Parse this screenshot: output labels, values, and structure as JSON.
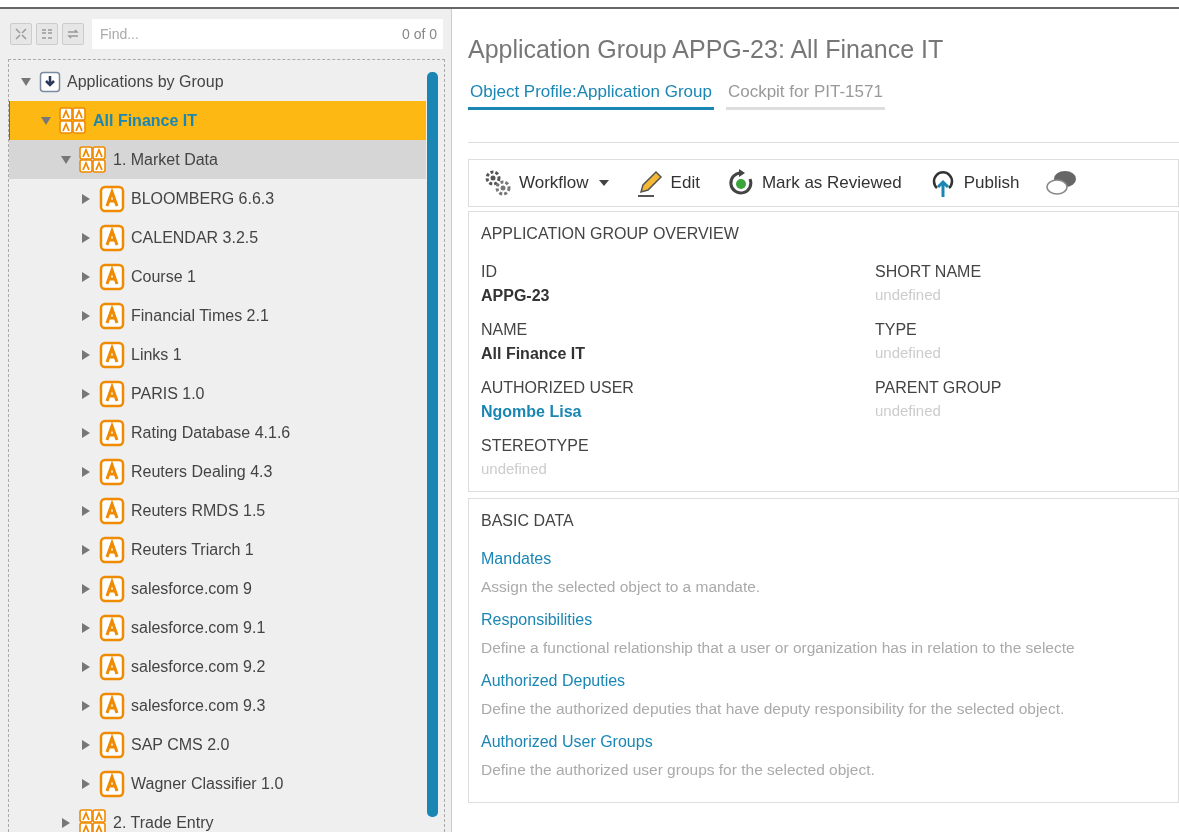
{
  "tree_toolbar": {
    "search": {
      "placeholder": "Find..."
    },
    "match_count": "0 of 0"
  },
  "tree": [
    {
      "label": "Applications by Group",
      "kind": "root",
      "expanded": true,
      "selected": false,
      "highlighted": false,
      "children": [
        {
          "label": "All Finance IT",
          "kind": "group",
          "expanded": true,
          "selected": true,
          "highlighted": false,
          "children": [
            {
              "label": "1. Market Data",
              "kind": "group",
              "expanded": true,
              "selected": false,
              "highlighted": true,
              "children": [
                {
                  "label": "BLOOMBERG 6.6.3",
                  "kind": "app",
                  "expanded": false,
                  "selected": false,
                  "highlighted": false
                },
                {
                  "label": "CALENDAR 3.2.5",
                  "kind": "app",
                  "expanded": false,
                  "selected": false,
                  "highlighted": false
                },
                {
                  "label": "Course 1",
                  "kind": "app",
                  "expanded": false,
                  "selected": false,
                  "highlighted": false
                },
                {
                  "label": "Financial Times 2.1",
                  "kind": "app",
                  "expanded": false,
                  "selected": false,
                  "highlighted": false
                },
                {
                  "label": "Links 1",
                  "kind": "app",
                  "expanded": false,
                  "selected": false,
                  "highlighted": false
                },
                {
                  "label": "PARIS 1.0",
                  "kind": "app",
                  "expanded": false,
                  "selected": false,
                  "highlighted": false
                },
                {
                  "label": "Rating Database 4.1.6",
                  "kind": "app",
                  "expanded": false,
                  "selected": false,
                  "highlighted": false
                },
                {
                  "label": "Reuters Dealing 4.3",
                  "kind": "app",
                  "expanded": false,
                  "selected": false,
                  "highlighted": false
                },
                {
                  "label": "Reuters RMDS 1.5",
                  "kind": "app",
                  "expanded": false,
                  "selected": false,
                  "highlighted": false
                },
                {
                  "label": "Reuters Triarch 1",
                  "kind": "app",
                  "expanded": false,
                  "selected": false,
                  "highlighted": false
                },
                {
                  "label": "salesforce.com 9",
                  "kind": "app",
                  "expanded": false,
                  "selected": false,
                  "highlighted": false
                },
                {
                  "label": "salesforce.com 9.1",
                  "kind": "app",
                  "expanded": false,
                  "selected": false,
                  "highlighted": false
                },
                {
                  "label": "salesforce.com 9.2",
                  "kind": "app",
                  "expanded": false,
                  "selected": false,
                  "highlighted": false
                },
                {
                  "label": "salesforce.com 9.3",
                  "kind": "app",
                  "expanded": false,
                  "selected": false,
                  "highlighted": false
                },
                {
                  "label": "SAP CMS 2.0",
                  "kind": "app",
                  "expanded": false,
                  "selected": false,
                  "highlighted": false
                },
                {
                  "label": "Wagner Classifier 1.0",
                  "kind": "app",
                  "expanded": false,
                  "selected": false,
                  "highlighted": false
                }
              ]
            },
            {
              "label": "2. Trade Entry",
              "kind": "group",
              "expanded": false,
              "selected": false,
              "highlighted": false
            }
          ]
        }
      ]
    }
  ],
  "page_title": "Application Group APPG-23: All Finance IT",
  "tabs": [
    {
      "label": "Object Profile:Application Group",
      "selected": true
    },
    {
      "label": "Cockpit for PIT-1571",
      "selected": false
    }
  ],
  "toolbar": [
    {
      "label": "Workflow",
      "kind": "gears",
      "dropdown": true
    },
    {
      "label": "Edit",
      "kind": "pencil",
      "dropdown": false
    },
    {
      "label": "Mark as Reviewed",
      "kind": "review",
      "dropdown": false
    },
    {
      "label": "Publish",
      "kind": "publish",
      "dropdown": false
    },
    {
      "kind": "chat",
      "dropdown": false
    }
  ],
  "overview": {
    "title": "APPLICATION GROUP OVERVIEW",
    "fields": [
      {
        "label": "ID",
        "value": "APPG-23",
        "kind": "bold"
      },
      {
        "label": "SHORT NAME",
        "value": "undefined",
        "kind": "empty"
      },
      {
        "label": "NAME",
        "value": "All Finance IT",
        "kind": "bold"
      },
      {
        "label": "TYPE",
        "value": "undefined",
        "kind": "empty"
      },
      {
        "label": "AUTHORIZED USER",
        "value": "Ngombe Lisa",
        "kind": "link"
      },
      {
        "label": "PARENT GROUP",
        "value": "undefined",
        "kind": "empty"
      },
      {
        "label": "STEREOTYPE",
        "value": "undefined",
        "kind": "empty"
      }
    ]
  },
  "basic_data": {
    "title": "BASIC DATA",
    "items": [
      {
        "link": "Mandates",
        "description": "Assign the selected object to a mandate."
      },
      {
        "link": "Responsibilities",
        "description": "Define a functional relationship that a user or organization has in relation to the selecte"
      },
      {
        "link": "Authorized Deputies",
        "description": "Define the authorized deputies that have deputy responsibility for the selected object."
      },
      {
        "link": "Authorized User Groups",
        "description": "Define the authorized user groups for the selected object."
      }
    ]
  }
}
